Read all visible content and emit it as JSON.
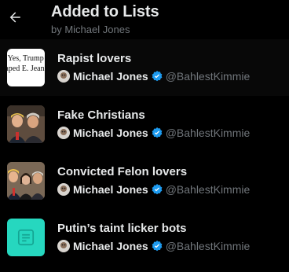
{
  "header": {
    "title": "Added to Lists",
    "subtitle": "by Michael Jones"
  },
  "lists": [
    {
      "name": "Rapist lovers",
      "owner": "Michael Jones",
      "handle": "@BahlestKimmie",
      "thumb_text_1": "e Yes, Trump",
      "thumb_text_2": "raped E. Jean"
    },
    {
      "name": "Fake Christians",
      "owner": "Michael Jones",
      "handle": "@BahlestKimmie"
    },
    {
      "name": "Convicted Felon lovers",
      "owner": "Michael Jones",
      "handle": "@BahlestKimmie"
    },
    {
      "name": "Putin’s taint licker bots",
      "owner": "Michael Jones",
      "handle": "@BahlestKimmie"
    }
  ],
  "colors": {
    "background": "#000000",
    "text_primary": "#e7e9ea",
    "text_secondary": "#71767b",
    "verified_blue": "#1d9bf0",
    "default_list_teal": "#26d7bf"
  },
  "icons": {
    "back": "arrow-left-icon",
    "verified": "verified-badge-icon",
    "default_list": "list-document-icon"
  }
}
